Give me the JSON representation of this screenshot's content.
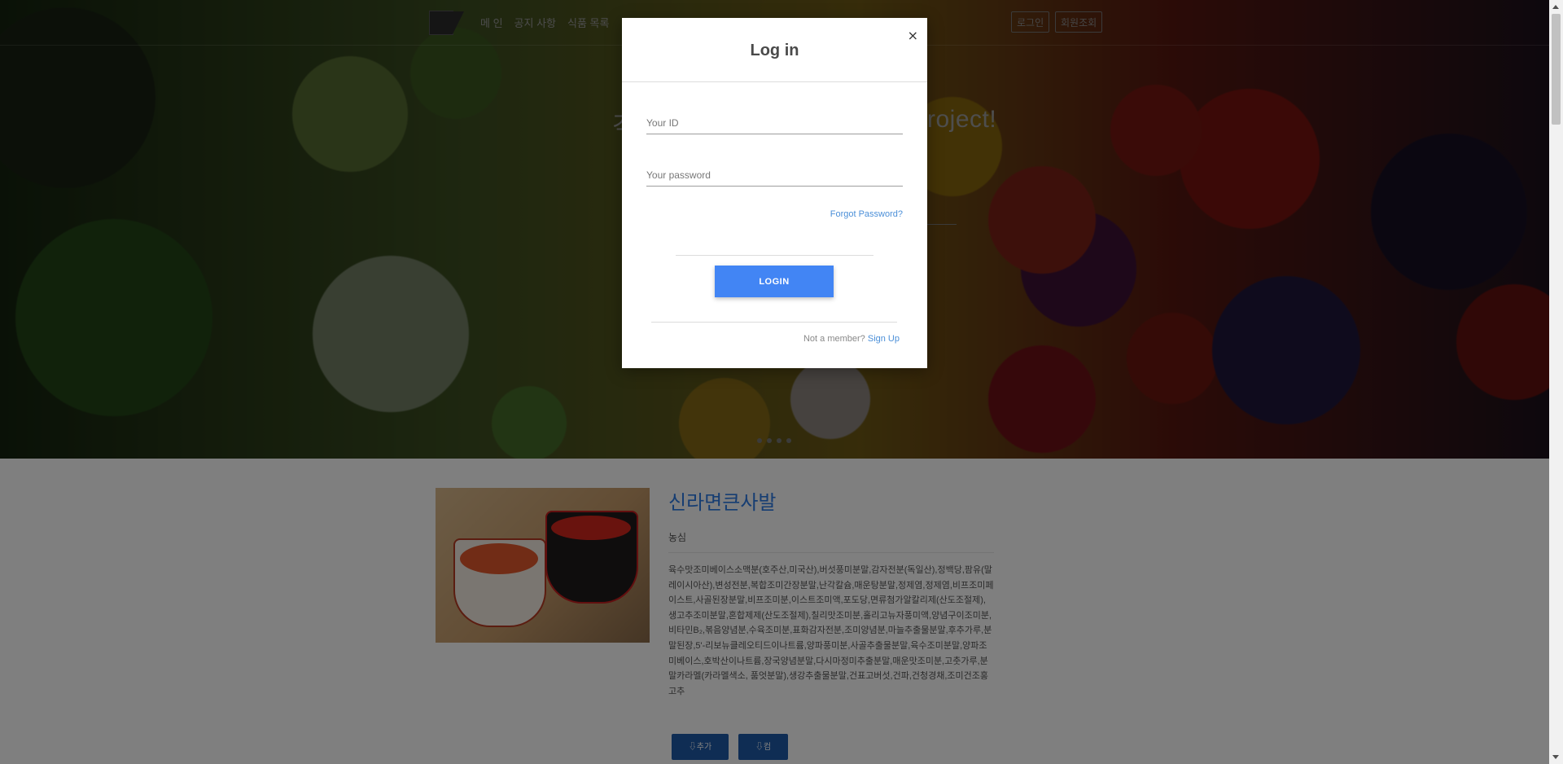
{
  "nav": {
    "links": [
      "메 인",
      "공지 사항",
      "식품 목록"
    ],
    "login_label": "로그인",
    "members_label": "회원조회"
  },
  "hero": {
    "heading_left": "걱",
    "heading_right": "roject!",
    "slide_count": 4
  },
  "product": {
    "title": "신라면큰사발",
    "brand": "농심",
    "ingredients": "육수맛조미베이스소맥분(호주산,미국산),버섯풍미분말,감자전분(독일산),정백당,팜유(말레이시아산),변성전분,복합조미간장분말,난각칼슘,매운탕분말,정제염,정제염,비프조미페이스트,사골된장분말,비프조미분,이스트조미액,포도당,면류첨가알칼리제(산도조절제),생고추조미분말,혼합제제(산도조절제),칠리맛조미분,홀리고뉴자풍미액,양념구이조미분,비타민B₂,볶음양념분,수육조미분,표화감자전분,조미양념분,마늘추출물분말,후추가루,분말된장,5'-리보뉴클레오티드이나트륨,양파풍미분,사골추출물분말,육수조미분말,양파조미베이스,호박산이나트륨,장국양념분말,다시마정미추출분말,매운맛조미분,고춧가루,분말카라멜(카라멜색소, 품엇분말),생강추출물분말,건표고버섯,건파,건청경채,조미건조홍고추",
    "add_label": "추가",
    "download_label": "컴"
  },
  "modal": {
    "title": "Log in",
    "close_label": "×",
    "id_placeholder": "Your ID",
    "password_placeholder": "Your password",
    "forgot_label": "Forgot Password?",
    "login_label": "LOGIN",
    "not_member_label": "Not a member?",
    "signup_label": "Sign Up"
  }
}
